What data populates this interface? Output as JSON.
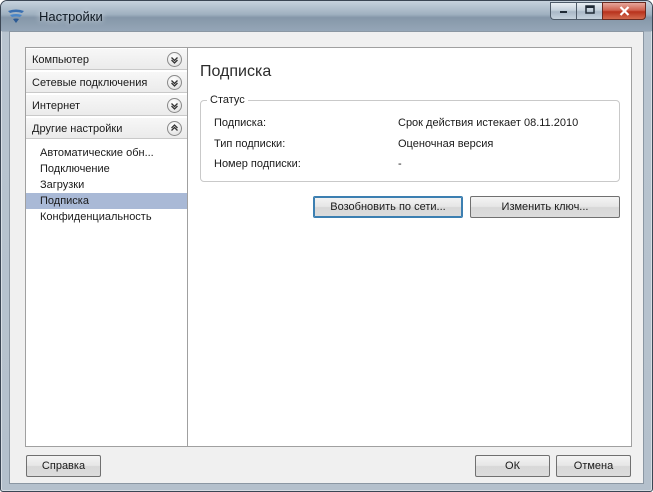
{
  "window": {
    "title": "Настройки"
  },
  "sidebar": {
    "sections": [
      {
        "label": "Компьютер",
        "expanded": false
      },
      {
        "label": "Сетевые подключения",
        "expanded": false
      },
      {
        "label": "Интернет",
        "expanded": false
      },
      {
        "label": "Другие настройки",
        "expanded": true
      }
    ],
    "items": [
      {
        "label": "Автоматические обн..."
      },
      {
        "label": "Подключение"
      },
      {
        "label": "Загрузки"
      },
      {
        "label": "Подписка",
        "selected": true
      },
      {
        "label": "Конфиденциальность"
      }
    ]
  },
  "main": {
    "title": "Подписка",
    "status_group": {
      "legend": "Статус",
      "rows": [
        {
          "label": "Подписка:",
          "value": "Срок действия истекает 08.11.2010"
        },
        {
          "label": "Тип подписки:",
          "value": "Оценочная версия"
        },
        {
          "label": "Номер подписки:",
          "value": "-"
        }
      ]
    },
    "renew_button": "Возобновить по сети...",
    "change_key_button": "Изменить ключ..."
  },
  "footer": {
    "help_button": "Справка",
    "ok_button": "ОК",
    "cancel_button": "Отмена"
  },
  "icons": {
    "app": "app-logo-icon",
    "minimize": "minimize-icon",
    "maximize": "maximize-icon",
    "close": "close-icon",
    "collapse": "chevron-up-icon",
    "expand": "chevron-down-icon"
  }
}
